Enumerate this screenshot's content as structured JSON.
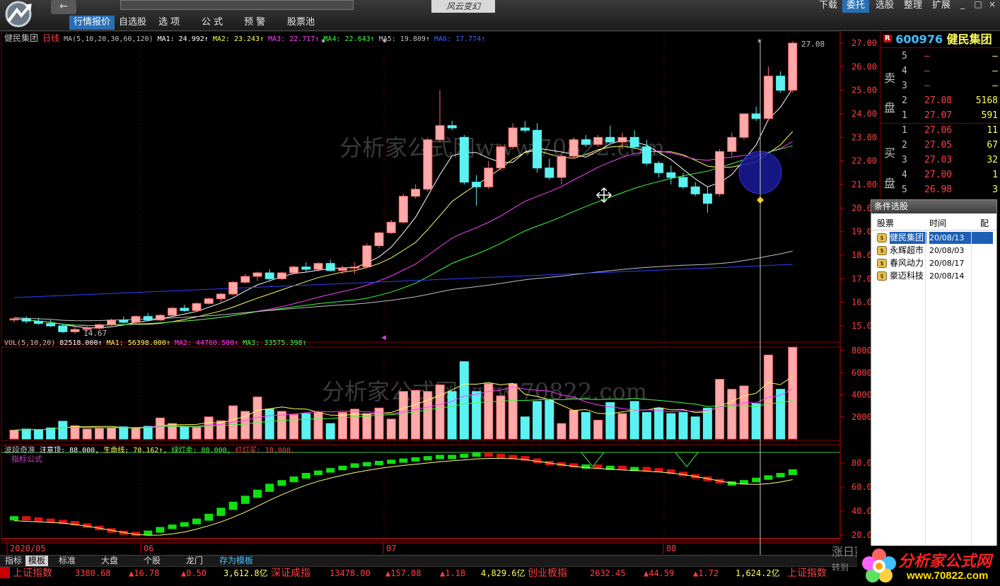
{
  "top_nav": {
    "back_label": "←",
    "tabs": [
      "行情报价",
      "自选股",
      "选 项",
      "公 式",
      "预 警",
      "股票池"
    ],
    "active_tab": 0,
    "slogan": "风云变幻"
  },
  "top_right": {
    "tabs": [
      "下载",
      "委托",
      "选股",
      "整理",
      "扩展"
    ],
    "active": 1,
    "window_buttons": [
      "_",
      "□",
      "×"
    ]
  },
  "main_chart": {
    "header": {
      "stock_name": "健民集团",
      "period": "日线",
      "ma_params": "MA(5,10,20,30,60,120)",
      "ma1": "MA1: 24.992↑",
      "ma2": "MA2: 23.243↑",
      "ma3": "MA3: 22.717↑",
      "ma4": "MA4: 22.643↑",
      "ma5": "MA5: 19.809↑",
      "ma6": "MA6: 17.774↑"
    },
    "watermark": "分析家公式网www.70822.com",
    "high_label": "27.08",
    "low_label": "14.67",
    "y_ticks": [
      "27.00",
      "26.00",
      "25.00",
      "24.00",
      "23.00",
      "22.00",
      "21.00",
      "20.00",
      "19.00",
      "18.00",
      "17.00",
      "16.00",
      "15.00"
    ]
  },
  "volume_panel": {
    "header": {
      "params": "VOL(5,10,20)",
      "value": "82518.000↑",
      "ma1": "MA1: 56398.000↑",
      "ma2": "MA2: 44760.500↑",
      "ma3": "MA3: 33575.398↑"
    },
    "y_ticks": [
      "8000",
      "6000",
      "4000",
      "2000"
    ]
  },
  "indicator_panel": {
    "name": "波段奇准",
    "values": [
      "注意顶: 88.000,",
      "生命线: 70.162↑,",
      "绿灯卖: 88.000,",
      "红灯买: 18.000,"
    ],
    "sublabel": "指标公式",
    "y_ticks": [
      "80.0",
      "60.0",
      "40.0",
      "20.0"
    ]
  },
  "x_axis": {
    "labels": [
      "2020/05",
      "06",
      "07",
      "08"
    ]
  },
  "quote": {
    "code": "600976",
    "name": "健民集团",
    "sell_label": [
      "卖",
      "盘"
    ],
    "buy_label": [
      "买",
      "盘"
    ],
    "sell": [
      {
        "lvl": "5",
        "price": "–",
        "vol": "–"
      },
      {
        "lvl": "4",
        "price": "–",
        "vol": "–"
      },
      {
        "lvl": "3",
        "price": "–",
        "vol": "–"
      },
      {
        "lvl": "2",
        "price": "27.08",
        "vol": "5168"
      },
      {
        "lvl": "1",
        "price": "27.07",
        "vol": "591"
      }
    ],
    "buy": [
      {
        "lvl": "1",
        "price": "27.06",
        "vol": "11"
      },
      {
        "lvl": "2",
        "price": "27.05",
        "vol": "67"
      },
      {
        "lvl": "3",
        "price": "27.03",
        "vol": "32"
      },
      {
        "lvl": "4",
        "price": "27.00",
        "vol": "1"
      },
      {
        "lvl": "5",
        "price": "26.98",
        "vol": "3"
      }
    ]
  },
  "condition_picker": {
    "title": "条件选股",
    "columns": [
      "股票",
      "时间",
      "配"
    ],
    "rows": [
      {
        "name": "健民集团",
        "date": "20/08/13",
        "selected": true
      },
      {
        "name": "永辉超市",
        "date": "20/08/03",
        "selected": false
      },
      {
        "name": "春风动力",
        "date": "20/08/17",
        "selected": false
      },
      {
        "name": "豪迈科技",
        "date": "20/08/14",
        "selected": false
      }
    ]
  },
  "bottom_tabs": [
    "指标",
    "模板",
    "标准",
    "大盘",
    "个股",
    "龙门",
    "存为模板"
  ],
  "ticker": {
    "sh_name": "上证指数",
    "sh_value": "3380.68",
    "sh_change": "▲16.78",
    "sh_pct": "▲0.50",
    "sh_amount": "3,612.8亿",
    "sz_name": "深证成指",
    "sz_value": "13478.00",
    "sz_change": "▲157.08",
    "sz_pct": "▲1.18",
    "sz_amount": "4,829.6亿",
    "cy_name": "创业板指",
    "cy_value": "2632.45",
    "cy_change": "▲44.59",
    "cy_pct": "▲1.72",
    "cy_amount": "1,624.2亿",
    "sh2_name": "上证指数",
    "scroll_hint": "转到",
    "brand_hint": "涨日赛"
  },
  "brand": {
    "name": "分析家公式网",
    "url": "www.70822.com"
  },
  "chart_data": {
    "type": "candlestick",
    "ohlc": [
      [
        15.25,
        15.35,
        15.15,
        15.3
      ],
      [
        15.3,
        15.4,
        15.1,
        15.2
      ],
      [
        15.2,
        15.35,
        15.05,
        15.1
      ],
      [
        15.1,
        15.25,
        14.95,
        15.0
      ],
      [
        15.0,
        15.1,
        14.7,
        14.75
      ],
      [
        14.75,
        14.95,
        14.67,
        14.85
      ],
      [
        14.85,
        15.0,
        14.75,
        14.9
      ],
      [
        14.9,
        15.1,
        14.85,
        15.05
      ],
      [
        15.05,
        15.3,
        15.0,
        15.25
      ],
      [
        15.25,
        15.4,
        15.1,
        15.15
      ],
      [
        15.15,
        15.45,
        15.1,
        15.4
      ],
      [
        15.4,
        15.55,
        15.2,
        15.25
      ],
      [
        15.25,
        15.5,
        15.2,
        15.45
      ],
      [
        15.45,
        15.8,
        15.4,
        15.75
      ],
      [
        15.75,
        15.9,
        15.6,
        15.65
      ],
      [
        15.65,
        16.0,
        15.6,
        15.95
      ],
      [
        15.95,
        16.2,
        15.9,
        16.15
      ],
      [
        16.15,
        16.4,
        16.0,
        16.35
      ],
      [
        16.35,
        16.9,
        16.3,
        16.85
      ],
      [
        16.85,
        17.2,
        16.8,
        17.1
      ],
      [
        17.1,
        17.3,
        16.9,
        17.25
      ],
      [
        17.25,
        17.4,
        16.9,
        17.0
      ],
      [
        17.0,
        17.3,
        16.95,
        17.25
      ],
      [
        17.25,
        17.55,
        17.2,
        17.5
      ],
      [
        17.5,
        17.7,
        17.3,
        17.4
      ],
      [
        17.4,
        17.7,
        17.3,
        17.65
      ],
      [
        17.65,
        17.8,
        17.3,
        17.35
      ],
      [
        17.35,
        17.55,
        17.2,
        17.45
      ],
      [
        17.45,
        17.7,
        17.2,
        17.5
      ],
      [
        17.5,
        18.5,
        17.45,
        18.4
      ],
      [
        18.4,
        19.0,
        18.3,
        18.95
      ],
      [
        18.95,
        19.5,
        18.9,
        19.4
      ],
      [
        19.4,
        20.6,
        19.35,
        20.5
      ],
      [
        20.5,
        21.0,
        20.4,
        20.8
      ],
      [
        20.8,
        23.0,
        20.7,
        22.9
      ],
      [
        22.9,
        25.0,
        22.8,
        23.5
      ],
      [
        23.5,
        23.7,
        23.3,
        23.4
      ],
      [
        23.0,
        23.1,
        21.0,
        21.1
      ],
      [
        21.1,
        21.4,
        20.1,
        20.9
      ],
      [
        20.9,
        22.0,
        20.8,
        21.7
      ],
      [
        21.7,
        22.7,
        21.6,
        22.6
      ],
      [
        22.6,
        23.6,
        22.5,
        23.4
      ],
      [
        23.4,
        23.7,
        23.2,
        23.3
      ],
      [
        23.3,
        23.6,
        21.5,
        21.7
      ],
      [
        21.7,
        22.1,
        21.2,
        21.3
      ],
      [
        21.3,
        22.3,
        21.0,
        22.2
      ],
      [
        22.2,
        23.0,
        22.1,
        22.9
      ],
      [
        22.9,
        23.1,
        22.6,
        22.7
      ],
      [
        22.7,
        23.1,
        22.6,
        23.0
      ],
      [
        23.0,
        23.5,
        22.7,
        22.8
      ],
      [
        22.8,
        23.2,
        22.5,
        23.0
      ],
      [
        23.0,
        23.3,
        22.5,
        22.6
      ],
      [
        22.6,
        22.9,
        21.8,
        21.9
      ],
      [
        21.9,
        22.0,
        21.3,
        21.5
      ],
      [
        21.5,
        21.8,
        21.0,
        21.3
      ],
      [
        21.3,
        21.5,
        20.8,
        20.9
      ],
      [
        20.9,
        21.1,
        20.5,
        20.6
      ],
      [
        20.6,
        20.9,
        19.8,
        20.2
      ],
      [
        20.6,
        22.5,
        20.5,
        22.4
      ],
      [
        22.4,
        23.2,
        22.2,
        23.0
      ],
      [
        23.0,
        24.0,
        22.9,
        24.0
      ],
      [
        24.0,
        24.3,
        23.7,
        23.8
      ],
      [
        23.8,
        26.0,
        23.7,
        25.6
      ],
      [
        25.6,
        25.8,
        24.9,
        25.0
      ],
      [
        25.0,
        27.08,
        24.9,
        27.0
      ]
    ],
    "volume": [
      800,
      900,
      850,
      1000,
      1600,
      1200,
      900,
      950,
      1000,
      1100,
      950,
      1150,
      1900,
      1400,
      1100,
      1050,
      2000,
      1650,
      3000,
      2500,
      3800,
      2700,
      2500,
      2200,
      2300,
      2400,
      1400,
      2400,
      2700,
      2300,
      2800,
      1800,
      4300,
      4400,
      4300,
      4900,
      4300,
      7000,
      4300,
      5000,
      3900,
      5000,
      2000,
      3400,
      3500,
      1400,
      2600,
      2400,
      1700,
      3300,
      2300,
      3400,
      2400,
      2800,
      2300,
      2400,
      2000,
      2800,
      5400,
      4500,
      4800,
      3200,
      7600,
      4500,
      8300
    ],
    "indicator": [
      34,
      33,
      32,
      31,
      30,
      28,
      26,
      24,
      22,
      21,
      20,
      22,
      25,
      27,
      29,
      32,
      36,
      41,
      46,
      51,
      56,
      61,
      64,
      67,
      70,
      72,
      74,
      76,
      78,
      79,
      80,
      81,
      82,
      83,
      84,
      85,
      85,
      86,
      87,
      86,
      85,
      84,
      82,
      80,
      79,
      78,
      77,
      77,
      76,
      76,
      75,
      75,
      74,
      73,
      71,
      69,
      67,
      65,
      63,
      63,
      64,
      66,
      68,
      70,
      73
    ]
  }
}
